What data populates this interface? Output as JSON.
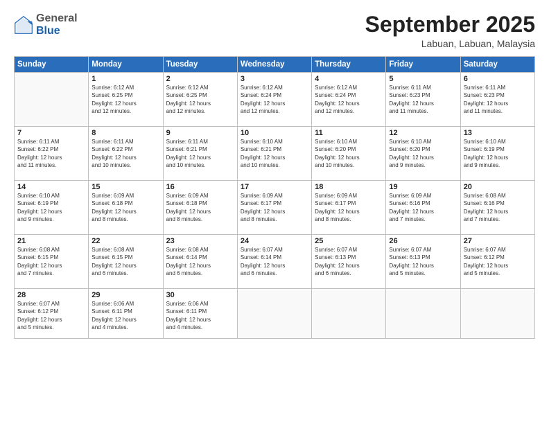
{
  "logo": {
    "general": "General",
    "blue": "Blue"
  },
  "title": "September 2025",
  "location": "Labuan, Labuan, Malaysia",
  "days_header": [
    "Sunday",
    "Monday",
    "Tuesday",
    "Wednesday",
    "Thursday",
    "Friday",
    "Saturday"
  ],
  "weeks": [
    [
      {
        "day": "",
        "info": ""
      },
      {
        "day": "1",
        "info": "Sunrise: 6:12 AM\nSunset: 6:25 PM\nDaylight: 12 hours\nand 12 minutes."
      },
      {
        "day": "2",
        "info": "Sunrise: 6:12 AM\nSunset: 6:25 PM\nDaylight: 12 hours\nand 12 minutes."
      },
      {
        "day": "3",
        "info": "Sunrise: 6:12 AM\nSunset: 6:24 PM\nDaylight: 12 hours\nand 12 minutes."
      },
      {
        "day": "4",
        "info": "Sunrise: 6:12 AM\nSunset: 6:24 PM\nDaylight: 12 hours\nand 12 minutes."
      },
      {
        "day": "5",
        "info": "Sunrise: 6:11 AM\nSunset: 6:23 PM\nDaylight: 12 hours\nand 11 minutes."
      },
      {
        "day": "6",
        "info": "Sunrise: 6:11 AM\nSunset: 6:23 PM\nDaylight: 12 hours\nand 11 minutes."
      }
    ],
    [
      {
        "day": "7",
        "info": "Sunrise: 6:11 AM\nSunset: 6:22 PM\nDaylight: 12 hours\nand 11 minutes."
      },
      {
        "day": "8",
        "info": "Sunrise: 6:11 AM\nSunset: 6:22 PM\nDaylight: 12 hours\nand 10 minutes."
      },
      {
        "day": "9",
        "info": "Sunrise: 6:11 AM\nSunset: 6:21 PM\nDaylight: 12 hours\nand 10 minutes."
      },
      {
        "day": "10",
        "info": "Sunrise: 6:10 AM\nSunset: 6:21 PM\nDaylight: 12 hours\nand 10 minutes."
      },
      {
        "day": "11",
        "info": "Sunrise: 6:10 AM\nSunset: 6:20 PM\nDaylight: 12 hours\nand 10 minutes."
      },
      {
        "day": "12",
        "info": "Sunrise: 6:10 AM\nSunset: 6:20 PM\nDaylight: 12 hours\nand 9 minutes."
      },
      {
        "day": "13",
        "info": "Sunrise: 6:10 AM\nSunset: 6:19 PM\nDaylight: 12 hours\nand 9 minutes."
      }
    ],
    [
      {
        "day": "14",
        "info": "Sunrise: 6:10 AM\nSunset: 6:19 PM\nDaylight: 12 hours\nand 9 minutes."
      },
      {
        "day": "15",
        "info": "Sunrise: 6:09 AM\nSunset: 6:18 PM\nDaylight: 12 hours\nand 8 minutes."
      },
      {
        "day": "16",
        "info": "Sunrise: 6:09 AM\nSunset: 6:18 PM\nDaylight: 12 hours\nand 8 minutes."
      },
      {
        "day": "17",
        "info": "Sunrise: 6:09 AM\nSunset: 6:17 PM\nDaylight: 12 hours\nand 8 minutes."
      },
      {
        "day": "18",
        "info": "Sunrise: 6:09 AM\nSunset: 6:17 PM\nDaylight: 12 hours\nand 8 minutes."
      },
      {
        "day": "19",
        "info": "Sunrise: 6:09 AM\nSunset: 6:16 PM\nDaylight: 12 hours\nand 7 minutes."
      },
      {
        "day": "20",
        "info": "Sunrise: 6:08 AM\nSunset: 6:16 PM\nDaylight: 12 hours\nand 7 minutes."
      }
    ],
    [
      {
        "day": "21",
        "info": "Sunrise: 6:08 AM\nSunset: 6:15 PM\nDaylight: 12 hours\nand 7 minutes."
      },
      {
        "day": "22",
        "info": "Sunrise: 6:08 AM\nSunset: 6:15 PM\nDaylight: 12 hours\nand 6 minutes."
      },
      {
        "day": "23",
        "info": "Sunrise: 6:08 AM\nSunset: 6:14 PM\nDaylight: 12 hours\nand 6 minutes."
      },
      {
        "day": "24",
        "info": "Sunrise: 6:07 AM\nSunset: 6:14 PM\nDaylight: 12 hours\nand 6 minutes."
      },
      {
        "day": "25",
        "info": "Sunrise: 6:07 AM\nSunset: 6:13 PM\nDaylight: 12 hours\nand 6 minutes."
      },
      {
        "day": "26",
        "info": "Sunrise: 6:07 AM\nSunset: 6:13 PM\nDaylight: 12 hours\nand 5 minutes."
      },
      {
        "day": "27",
        "info": "Sunrise: 6:07 AM\nSunset: 6:12 PM\nDaylight: 12 hours\nand 5 minutes."
      }
    ],
    [
      {
        "day": "28",
        "info": "Sunrise: 6:07 AM\nSunset: 6:12 PM\nDaylight: 12 hours\nand 5 minutes."
      },
      {
        "day": "29",
        "info": "Sunrise: 6:06 AM\nSunset: 6:11 PM\nDaylight: 12 hours\nand 4 minutes."
      },
      {
        "day": "30",
        "info": "Sunrise: 6:06 AM\nSunset: 6:11 PM\nDaylight: 12 hours\nand 4 minutes."
      },
      {
        "day": "",
        "info": ""
      },
      {
        "day": "",
        "info": ""
      },
      {
        "day": "",
        "info": ""
      },
      {
        "day": "",
        "info": ""
      }
    ]
  ]
}
